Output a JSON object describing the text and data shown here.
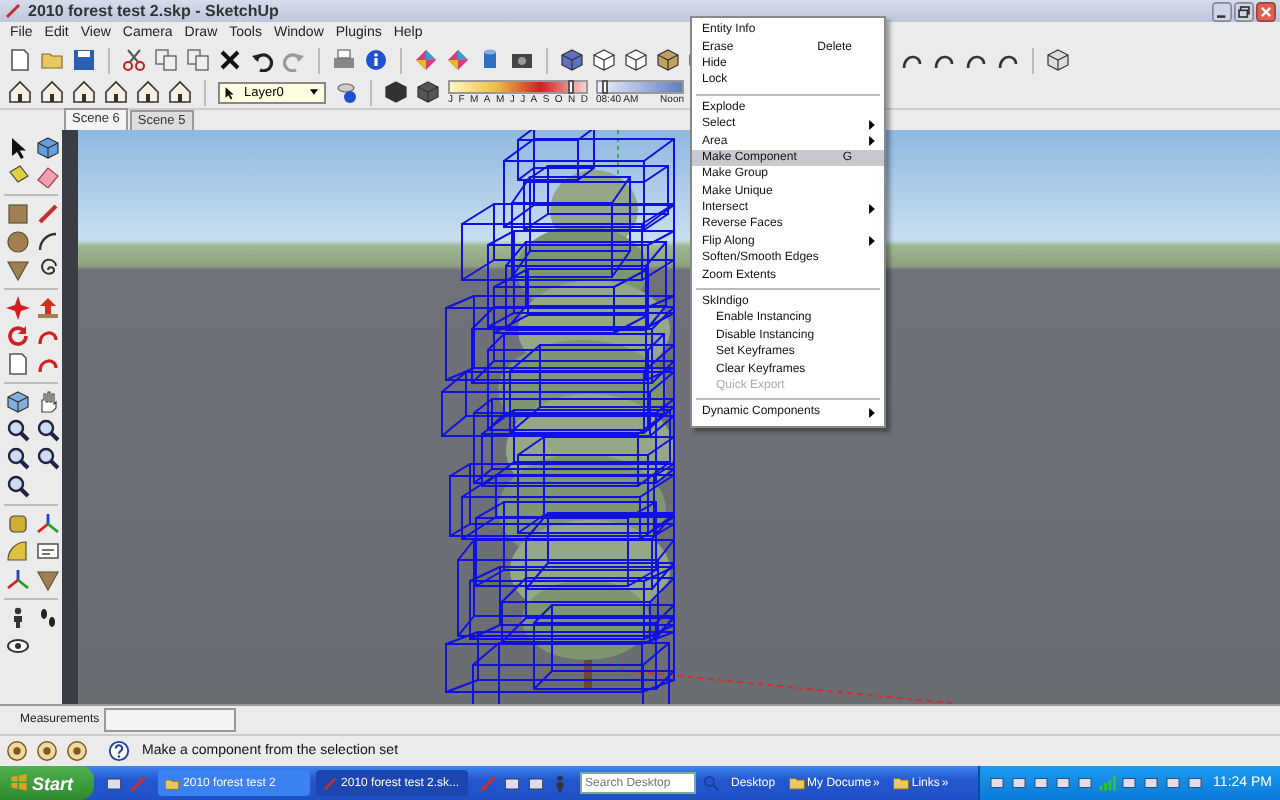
{
  "window": {
    "title": "2010 forest test 2.skp - SketchUp"
  },
  "menu_bar": [
    "File",
    "Edit",
    "View",
    "Camera",
    "Draw",
    "Tools",
    "Window",
    "Plugins",
    "Help"
  ],
  "toolbar": {
    "layer_dropdown": {
      "value": "Layer0"
    },
    "shadow_months": [
      "J",
      "F",
      "M",
      "A",
      "M",
      "J",
      "J",
      "A",
      "S",
      "O",
      "N",
      "D"
    ],
    "date_slider": {
      "level": 0.87
    },
    "time_slider": {
      "level": 0.05
    },
    "time_start": "08:40 AM",
    "time_noon": "Noon"
  },
  "scene_tabs": [
    {
      "label": "Scene 6",
      "selected": true
    },
    {
      "label": "Scene 5",
      "selected": false
    }
  ],
  "context_menu": [
    {
      "kind": "item",
      "label": "Entity Info",
      "selected": false,
      "disabled": false,
      "submenu": false
    },
    {
      "kind": "item",
      "label": "Erase",
      "shortcut": "Delete",
      "selected": false,
      "disabled": false,
      "submenu": false
    },
    {
      "kind": "item",
      "label": "Hide",
      "selected": false,
      "disabled": false,
      "submenu": false
    },
    {
      "kind": "item",
      "label": "Lock",
      "selected": false,
      "disabled": false,
      "submenu": false
    },
    {
      "kind": "separator"
    },
    {
      "kind": "item",
      "label": "Explode",
      "selected": false,
      "disabled": false,
      "submenu": false
    },
    {
      "kind": "item",
      "label": "Select",
      "selected": false,
      "disabled": false,
      "submenu": true
    },
    {
      "kind": "item",
      "label": "Area",
      "selected": false,
      "disabled": false,
      "submenu": true
    },
    {
      "kind": "item",
      "label": "Make Component",
      "shortcut": "G",
      "selected": true,
      "disabled": false,
      "submenu": false
    },
    {
      "kind": "item",
      "label": "Make Group",
      "selected": false,
      "disabled": false,
      "submenu": false
    },
    {
      "kind": "item",
      "label": "Make Unique",
      "selected": false,
      "disabled": false,
      "submenu": false
    },
    {
      "kind": "item",
      "label": "Intersect",
      "selected": false,
      "disabled": false,
      "submenu": true
    },
    {
      "kind": "item",
      "label": "Reverse Faces",
      "selected": false,
      "disabled": false,
      "submenu": false
    },
    {
      "kind": "item",
      "label": "Flip Along",
      "selected": false,
      "disabled": false,
      "submenu": true
    },
    {
      "kind": "item",
      "label": "Soften/Smooth Edges",
      "selected": false,
      "disabled": false,
      "submenu": false
    },
    {
      "kind": "item",
      "label": "Zoom Extents",
      "selected": false,
      "disabled": false,
      "submenu": false
    },
    {
      "kind": "separator"
    },
    {
      "kind": "item",
      "label": "SkIndigo",
      "selected": false,
      "disabled": false,
      "submenu": false
    },
    {
      "kind": "subitem",
      "label": "Enable Instancing",
      "selected": false,
      "disabled": false,
      "submenu": false
    },
    {
      "kind": "subitem",
      "label": "Disable Instancing",
      "selected": false,
      "disabled": false,
      "submenu": false
    },
    {
      "kind": "subitem",
      "label": "Set Keyframes",
      "selected": false,
      "disabled": false,
      "submenu": false
    },
    {
      "kind": "subitem",
      "label": "Clear Keyframes",
      "selected": false,
      "disabled": false,
      "submenu": false
    },
    {
      "kind": "subitem",
      "label": "Quick Export",
      "selected": false,
      "disabled": true,
      "submenu": false
    },
    {
      "kind": "separator"
    },
    {
      "kind": "item",
      "label": "Dynamic Components",
      "selected": false,
      "disabled": false,
      "submenu": true
    }
  ],
  "measurements": {
    "label": "Measurements"
  },
  "status_bar": {
    "hint": "Make a component from the selection set"
  },
  "taskbar": {
    "start": "Start",
    "tasks": [
      {
        "label": "2010 forest test 2",
        "selected": false
      },
      {
        "label": "2010 forest test 2.sk...",
        "selected": true
      }
    ],
    "search": {
      "placeholder": "Search Desktop"
    },
    "toolbars": [
      {
        "label": "Desktop"
      },
      {
        "label": "My Docume",
        "chevron": "»"
      },
      {
        "label": "Links",
        "chevron": "»"
      }
    ],
    "clock": "11:24 PM"
  }
}
